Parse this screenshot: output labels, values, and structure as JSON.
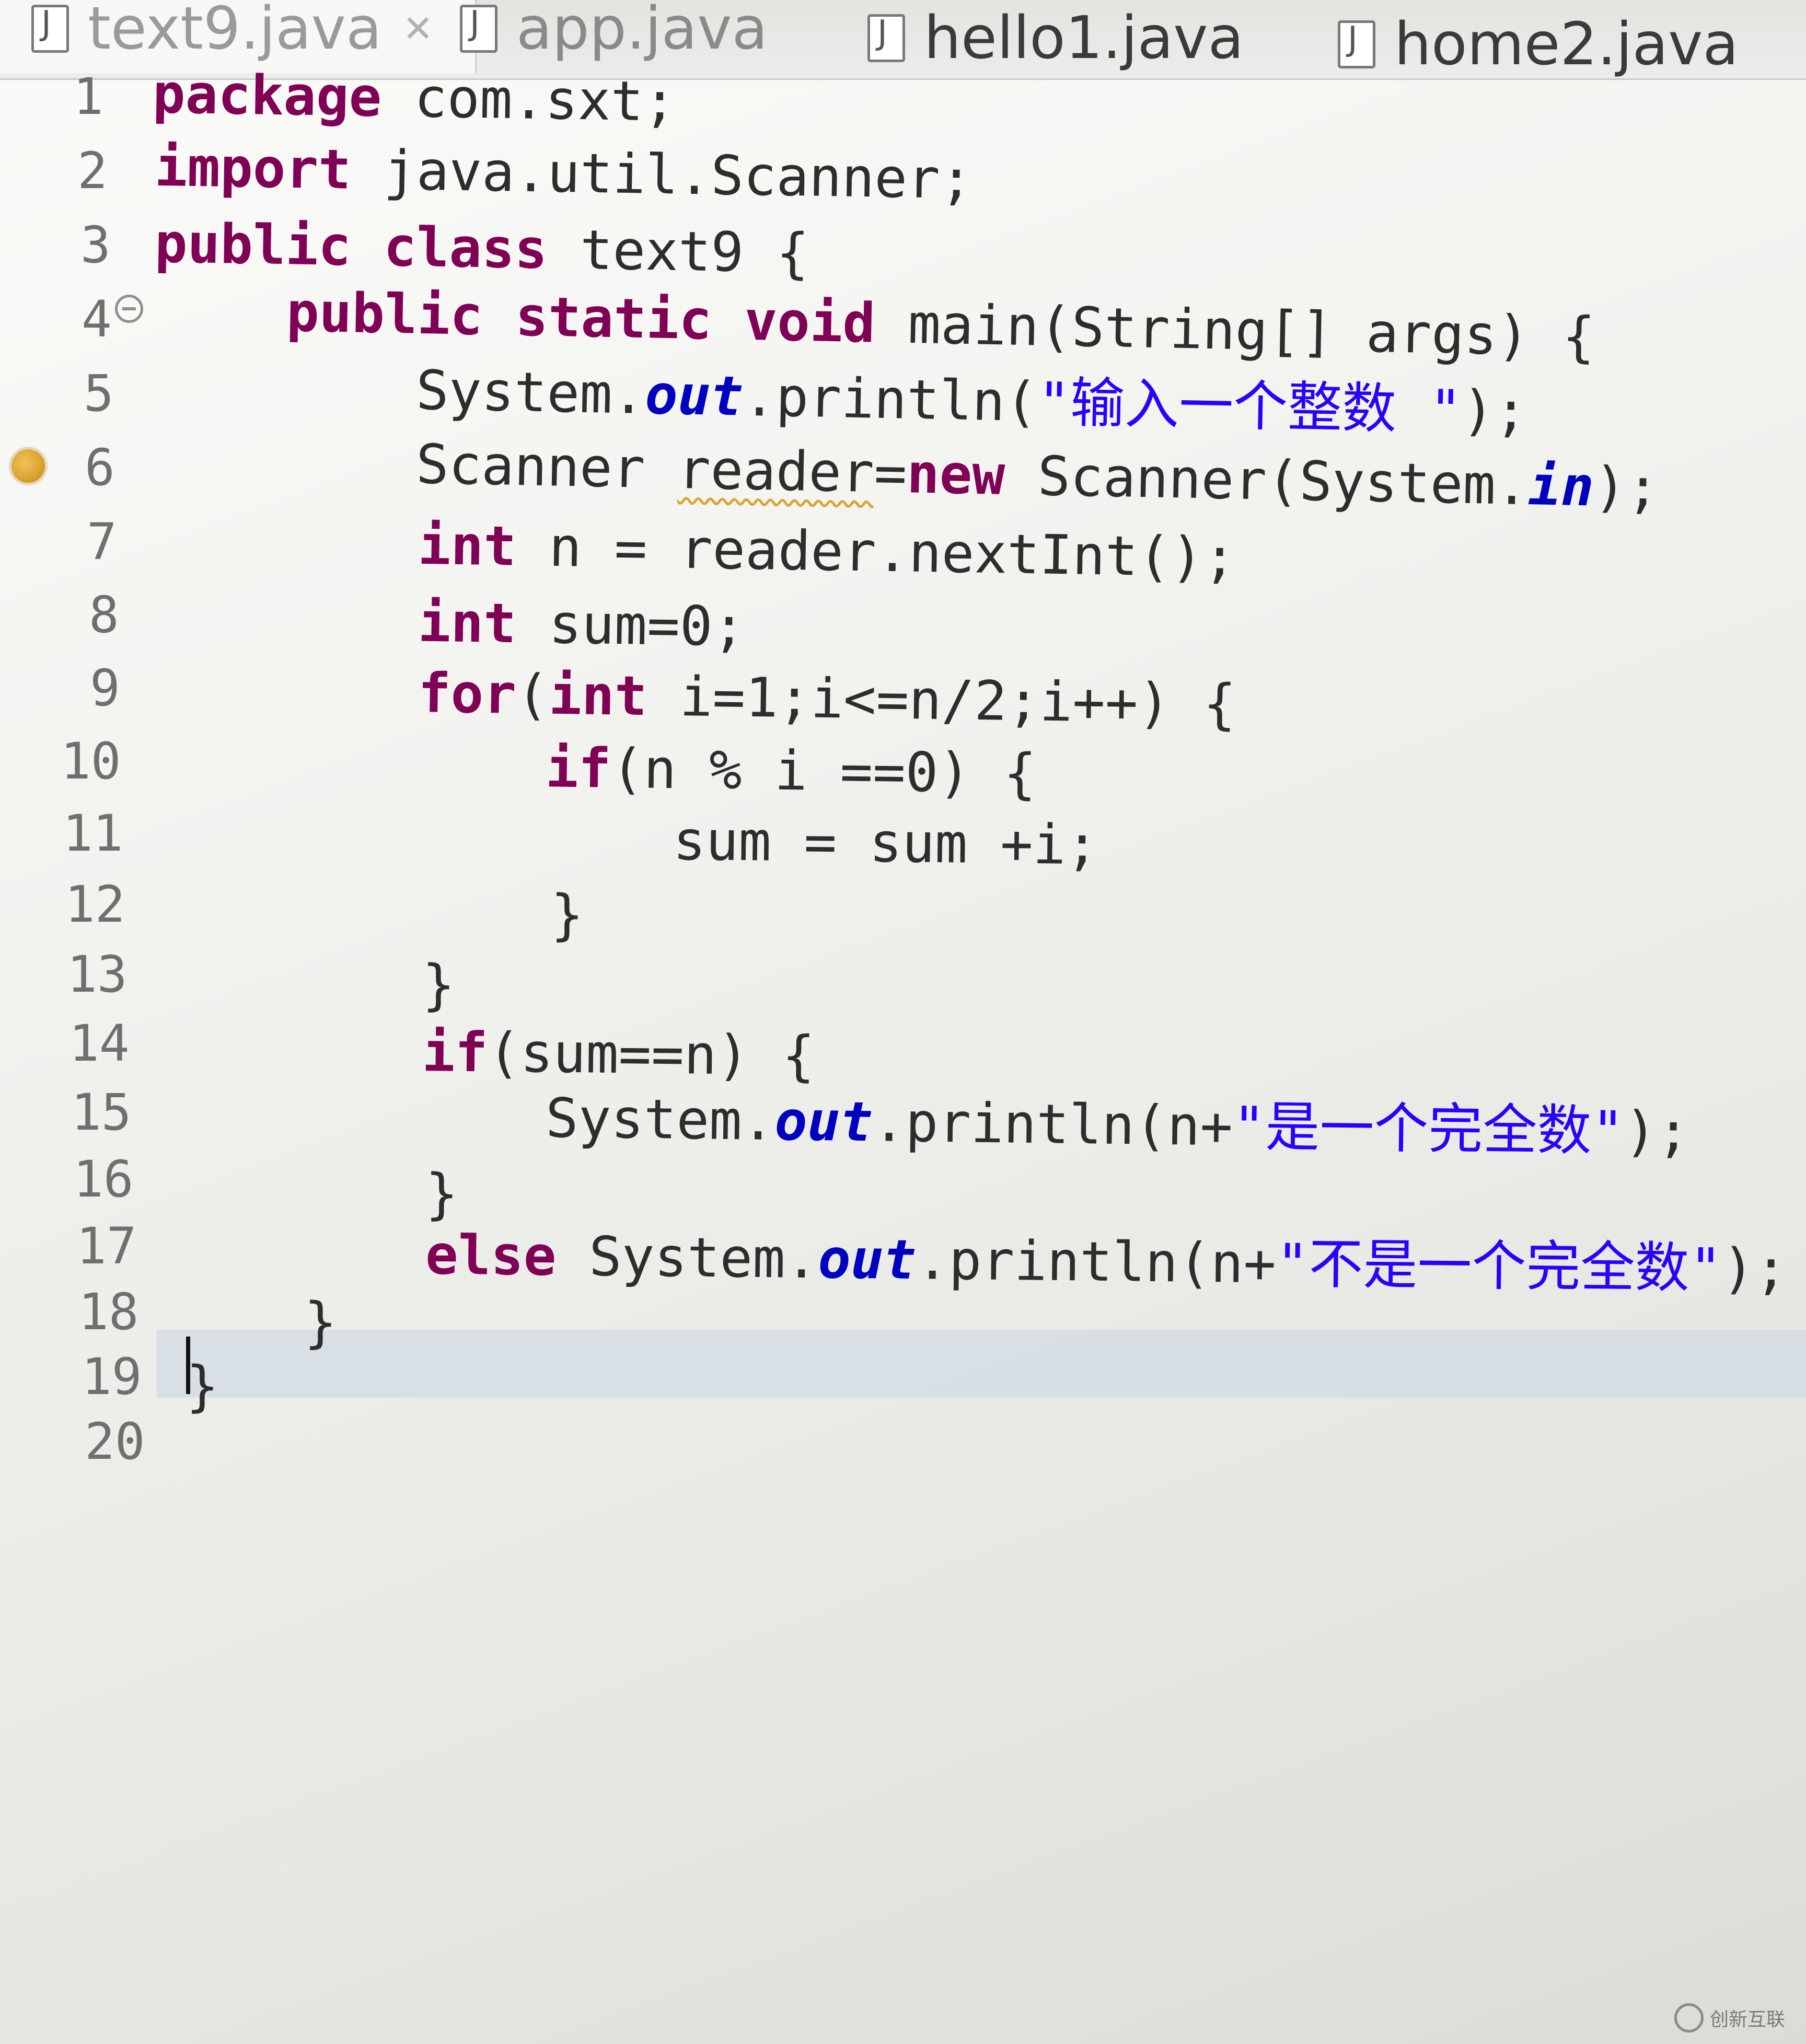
{
  "tabs": [
    {
      "label": "text9.java",
      "active": true
    },
    {
      "label": "app.java",
      "active": false
    },
    {
      "label": "hello1.java",
      "active": false
    },
    {
      "label": "home2.java",
      "active": false
    }
  ],
  "editor": {
    "line_numbers": [
      "1",
      "2",
      "3",
      "4",
      "5",
      "6",
      "7",
      "8",
      "9",
      "10",
      "11",
      "12",
      "13",
      "14",
      "15",
      "16",
      "17",
      "18",
      "19",
      "20"
    ],
    "lines": {
      "l1": {
        "kw": "package",
        "rest": " com.sxt;"
      },
      "l2": {
        "kw": "import",
        "rest": " java.util.Scanner;"
      },
      "l3": {
        "kw1": "public",
        "kw2": "class",
        "rest": " text9 {"
      },
      "l4": {
        "kw1": "public",
        "kw2": "static",
        "kw3": "void",
        "rest": " main(String[] args) {"
      },
      "l5": {
        "pre": "System.",
        "field": "out",
        "mid": ".println(",
        "str": "\"输入一个整数 \"",
        "post": ");"
      },
      "l6": {
        "pre": "Scanner ",
        "var": "reader",
        "eq": "=",
        "kw": "new",
        "mid": " Scanner(System.",
        "field": "in",
        "post": ");"
      },
      "l7": {
        "kw": "int",
        "rest": " n = reader.nextInt();"
      },
      "l8": {
        "kw": "int",
        "rest": " sum=0;"
      },
      "l9": {
        "kw1": "for",
        "p1": "(",
        "kw2": "int",
        "rest": " i=1;i<=n/2;i++) {"
      },
      "l10": {
        "kw": "if",
        "rest": "(n % i ==0) {"
      },
      "l11": {
        "rest": "sum = sum +i;"
      },
      "l12": {
        "rest": "}"
      },
      "l13": {
        "rest": "}"
      },
      "l14": {
        "kw": "if",
        "rest": "(sum==n) {"
      },
      "l15": {
        "pre": "System.",
        "field": "out",
        "mid": ".println(n+",
        "str": "\"是一个完全数\"",
        "post": ");"
      },
      "l16": {
        "rest": "}"
      },
      "l17": {
        "kw": "else",
        "pre": " System.",
        "field": "out",
        "mid": ".println(n+",
        "str": "\"不是一个完全数\"",
        "post": ");"
      },
      "l18": {
        "rest": "}"
      },
      "l19": {
        "rest": "}"
      },
      "l20": {
        "rest": ""
      }
    }
  },
  "watermark": {
    "label": "创新互联"
  },
  "colors": {
    "keyword": "#7f0055",
    "field": "#0000c0",
    "string": "#2a00ff",
    "current_line": "#c8d7e4"
  }
}
